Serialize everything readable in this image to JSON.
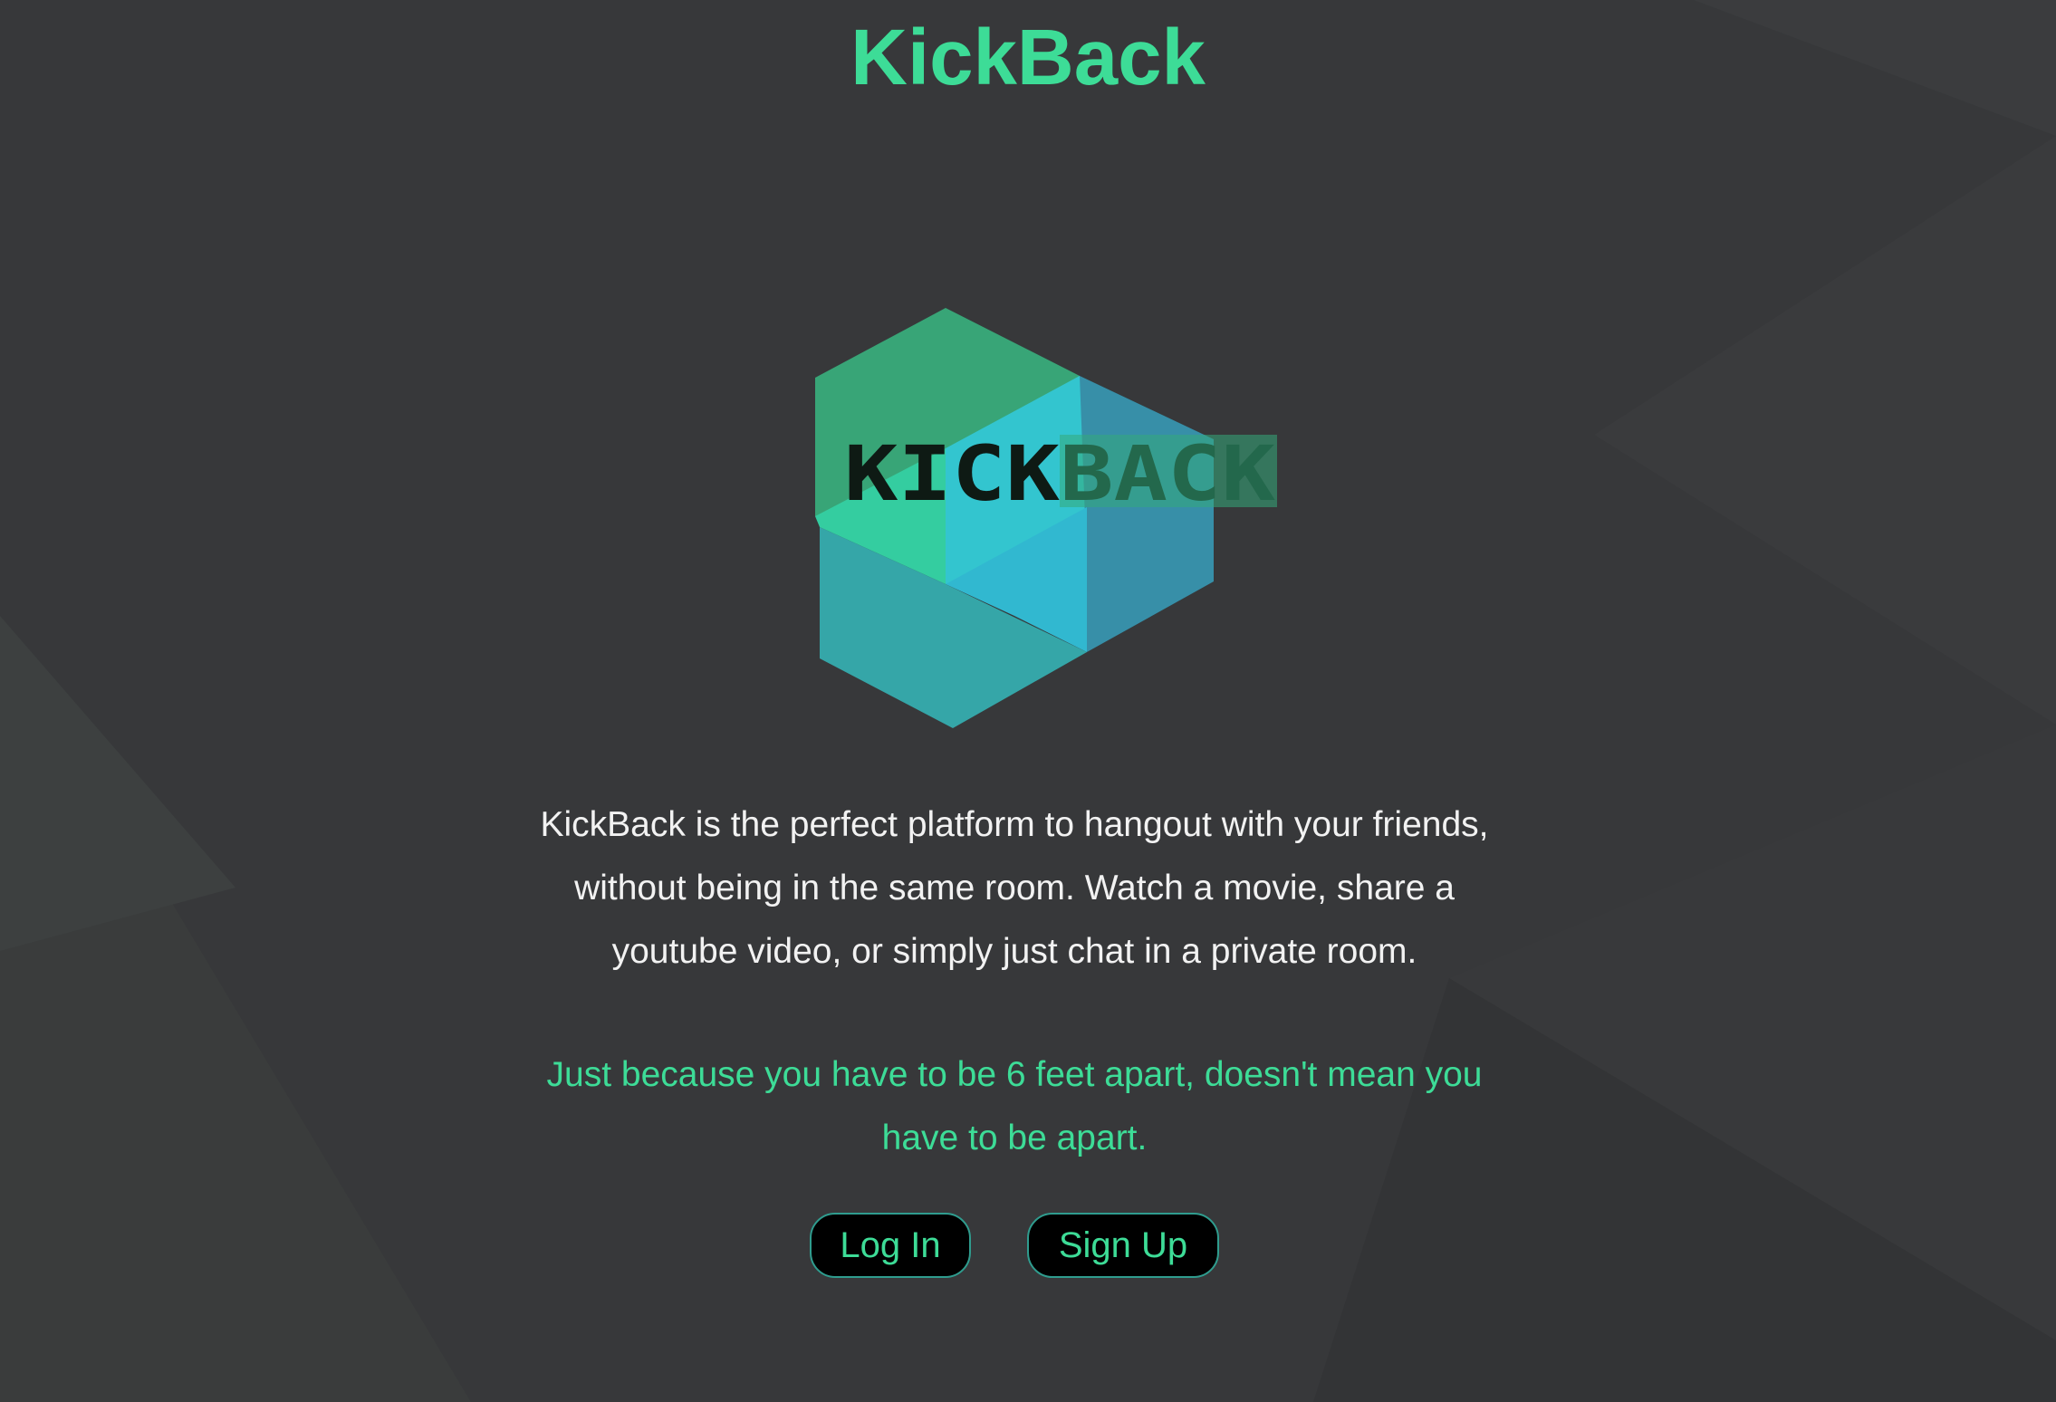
{
  "header": {
    "title": "KickBack"
  },
  "logo": {
    "text": "KICKBACK",
    "colors": {
      "green": "#38a577",
      "teal": "#35a6a8",
      "cyan": "#33c5cf",
      "blue": "#378fa8",
      "mint": "#34cda0"
    }
  },
  "main": {
    "description": "KickBack is the perfect platform to hangout with your friends, without being in the same room. Watch a movie, share a youtube video, or simply just chat in a private room.",
    "tagline": "Just because you have to be 6 feet apart, doesn't mean you have to be apart."
  },
  "actions": {
    "login_label": "Log In",
    "signup_label": "Sign Up"
  },
  "theme": {
    "background": "#37383a",
    "accent": "#3ddc97",
    "button_border": "#2f9c8e"
  }
}
